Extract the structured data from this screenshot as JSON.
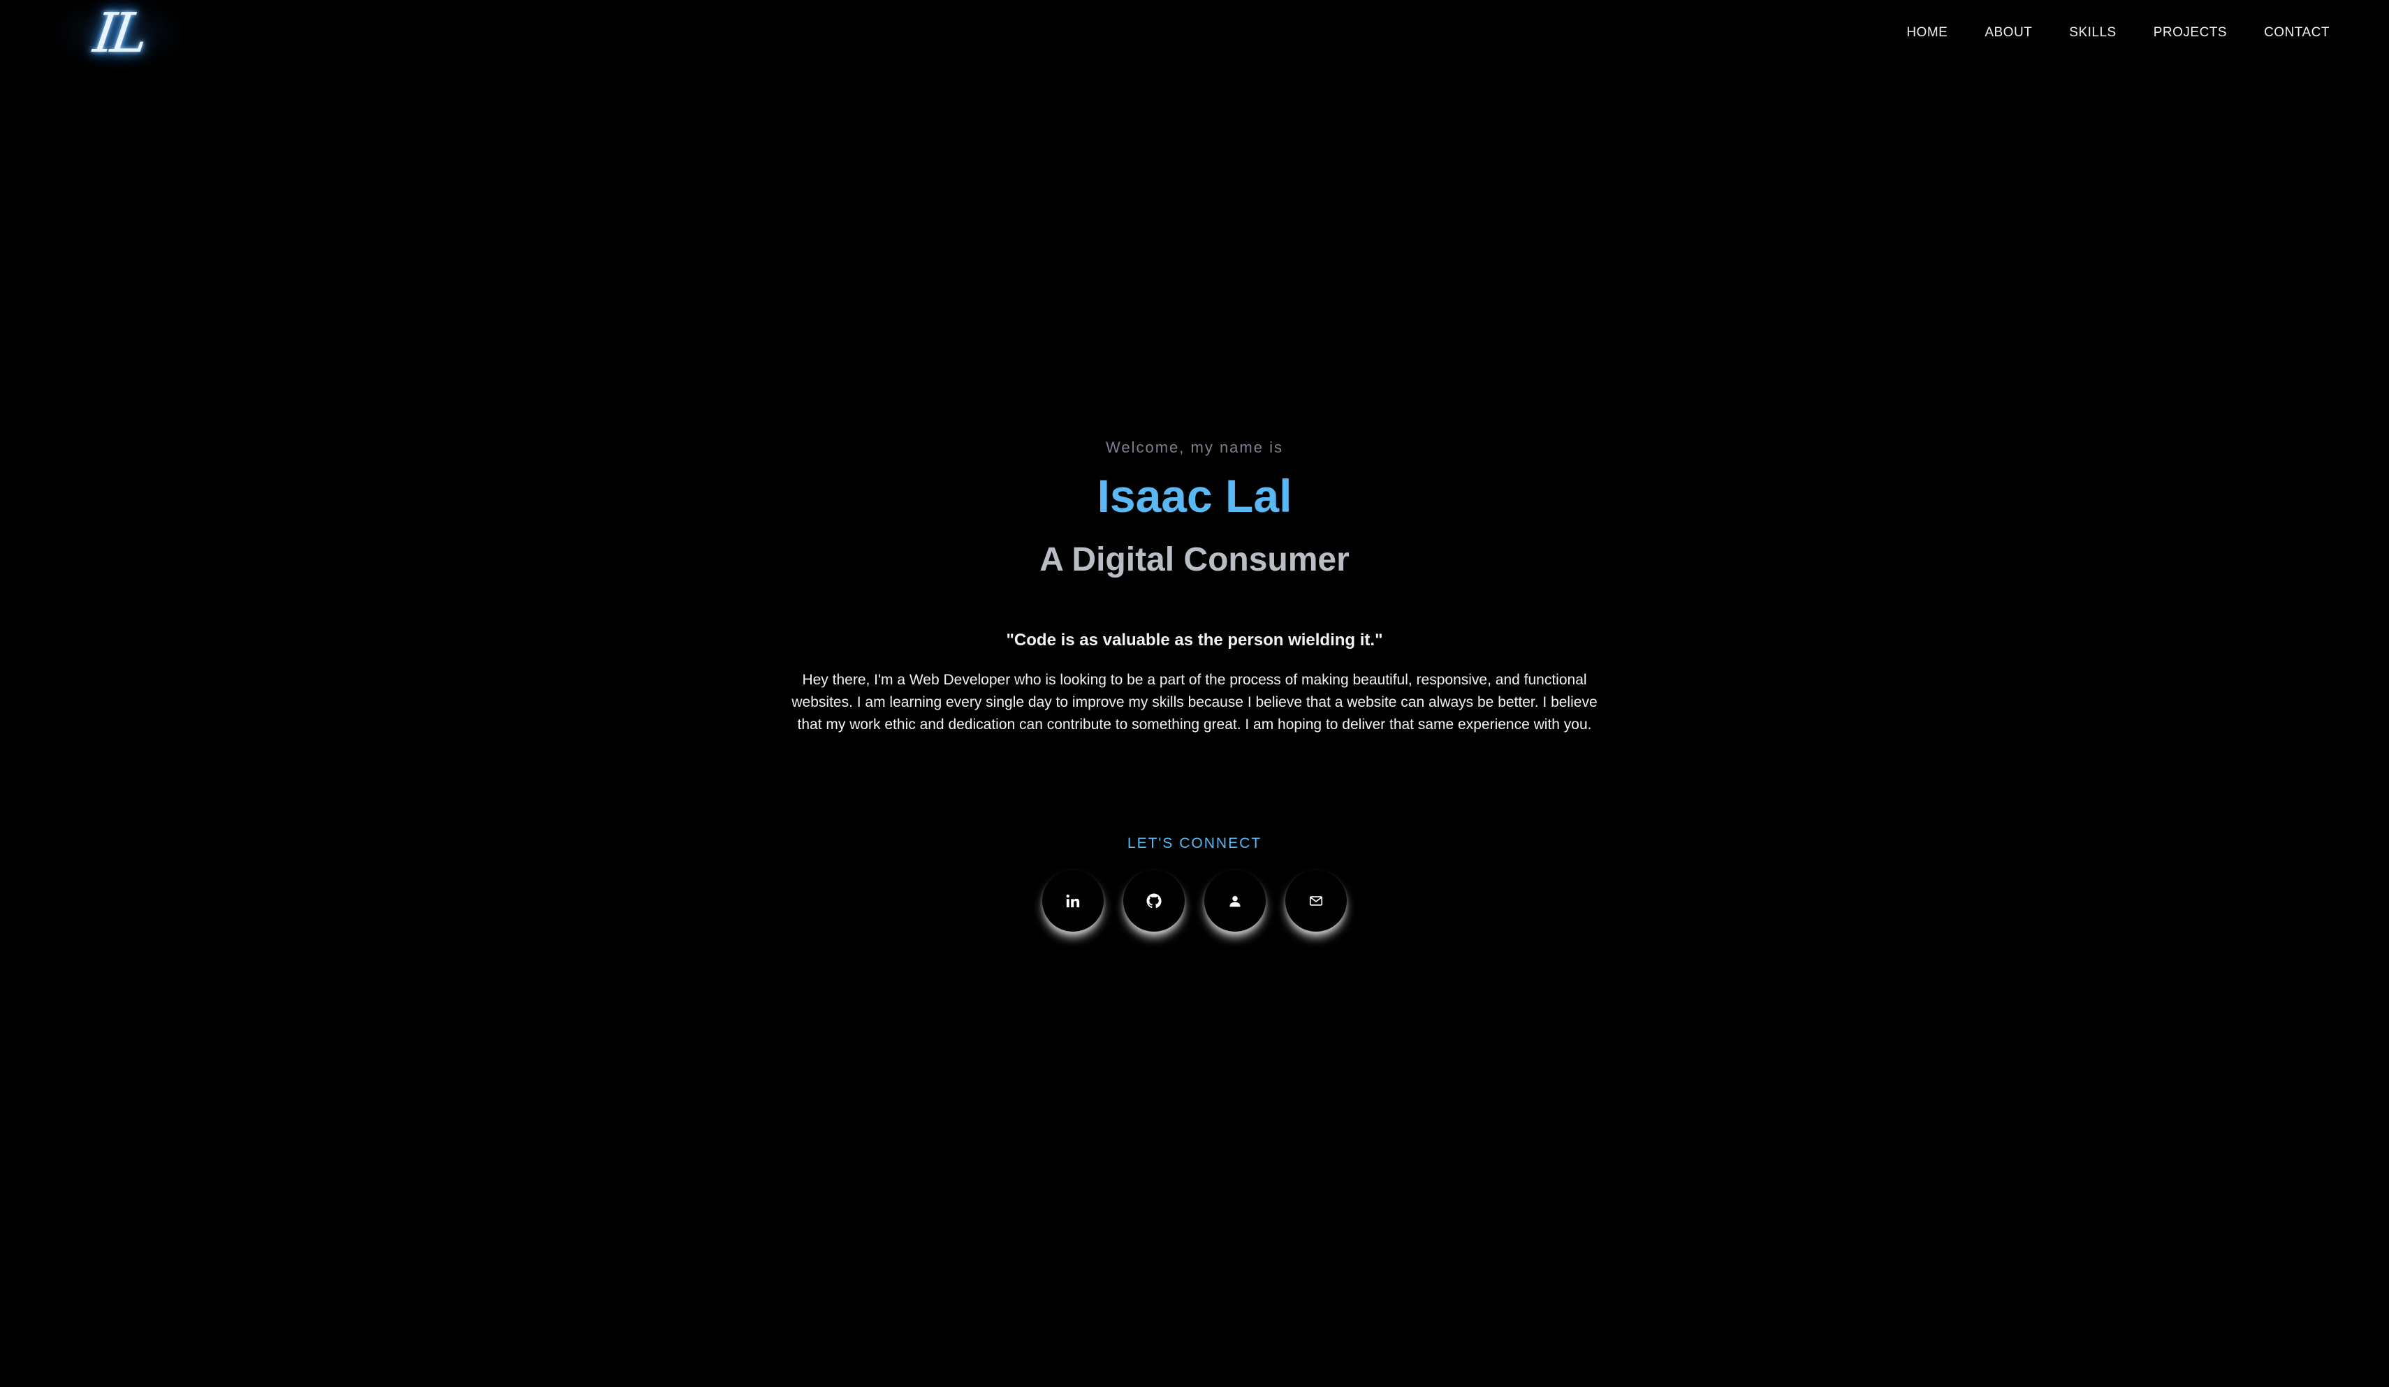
{
  "header": {
    "logo_text": "IL",
    "nav": [
      {
        "label": "HOME"
      },
      {
        "label": "ABOUT"
      },
      {
        "label": "SKILLS"
      },
      {
        "label": "PROJECTS"
      },
      {
        "label": "CONTACT"
      }
    ]
  },
  "hero": {
    "welcome": "Welcome, my name is",
    "name": "Isaac Lal",
    "role": "A Digital Consumer",
    "quote": "\"Code is as valuable as the person wielding it.\"",
    "bio": "Hey there, I'm a Web Developer who is looking to be a part of the process of making beautiful, responsive, and functional websites. I am learning every single day to improve my skills because I believe that a website can always be better. I believe that my work ethic and dedication can contribute to something great. I am hoping to deliver that same experience with you.",
    "connect_label": "LET'S CONNECT"
  },
  "socials": [
    {
      "icon": "linkedin-icon"
    },
    {
      "icon": "github-icon"
    },
    {
      "icon": "person-icon"
    },
    {
      "icon": "mail-icon"
    }
  ],
  "colors": {
    "background": "#000000",
    "accent": "#5ab8f5",
    "subtitle": "#b9bdc4",
    "muted": "#7a828e"
  }
}
